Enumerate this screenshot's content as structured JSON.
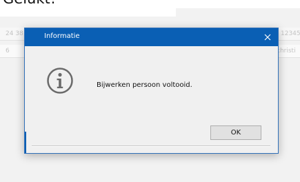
{
  "page": {
    "heading": "Gelukt!"
  },
  "background": {
    "row1_left": "24 38",
    "row1_right": "12345",
    "row2_left": "6",
    "row2_right": "christi"
  },
  "dialog": {
    "title": "Informatie",
    "message": "Bijwerken persoon voltooid.",
    "ok_label": "OK",
    "close_icon": "close-icon",
    "info_icon": "info-icon"
  },
  "colors": {
    "titlebar": "#0a5fb4",
    "dialog_bg": "#f0f0f0",
    "button_bg": "#e1e1e1"
  }
}
